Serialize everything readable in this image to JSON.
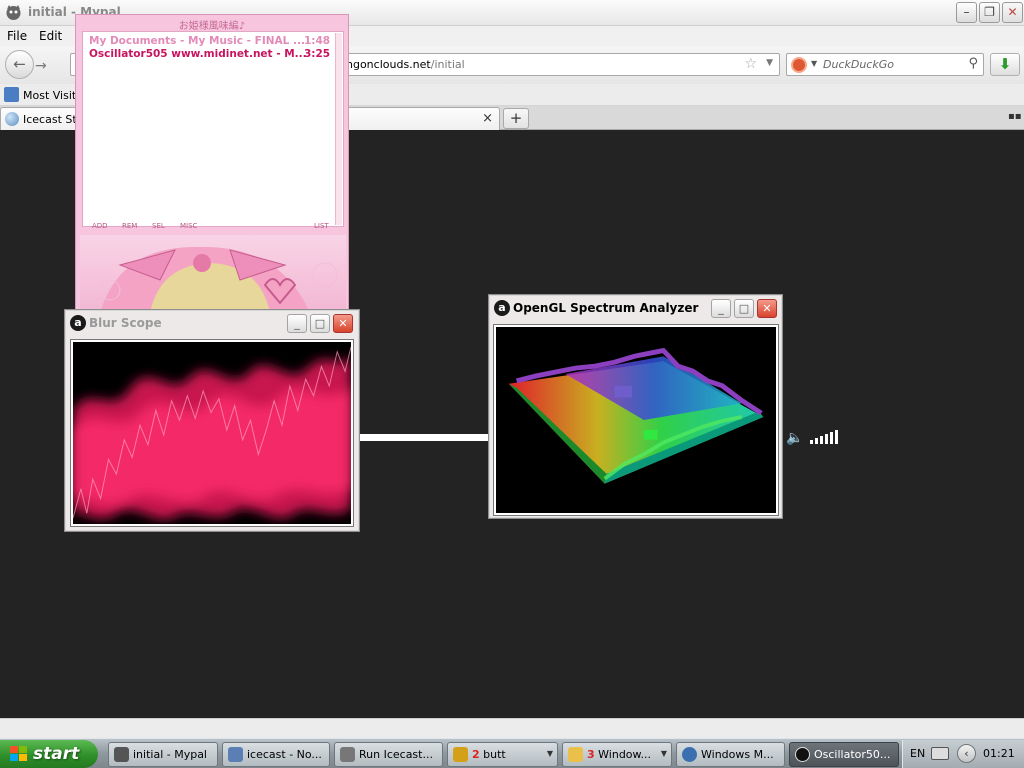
{
  "window": {
    "title": "initial - Mypal",
    "minimize_glyph": "–",
    "maximize_glyph": "❐",
    "close_glyph": "✕"
  },
  "menu": {
    "file": "File",
    "edit": "Edit"
  },
  "nav": {
    "back_glyph": "←",
    "forward_glyph": "→",
    "url_host": "ngonclouds.net",
    "url_path": "/initial",
    "star_glyph": "☆",
    "dropdown_glyph": "▼",
    "search_placeholder": "DuckDuckGo",
    "search_glyph": "⚲",
    "download_glyph": "⬇"
  },
  "bookmarks": {
    "most_visited": "Most Visite"
  },
  "tabs": {
    "active_label": "Icecast Str",
    "close_glyph": "×",
    "new_tab_glyph": "+",
    "all_tabs_glyph": "▪▪"
  },
  "playlist": {
    "title": "お姫様風味編♪",
    "items": [
      {
        "title": "My Documents - My Music - FINAL ...",
        "duration": "1:48",
        "color": "#e38ab8"
      },
      {
        "title": "Oscillator505 www.midinet.net - M...",
        "duration": "3:25",
        "color": "#c8145f"
      }
    ],
    "buttons": [
      "ADD",
      "REM",
      "SEL",
      "MISC",
      "LIST"
    ]
  },
  "blur_scope": {
    "title": "Blur Scope",
    "icon_glyph": "a",
    "min_glyph": "_",
    "max_glyph": "□",
    "close_glyph": "✕"
  },
  "spectrum": {
    "title": "OpenGL Spectrum Analyzer",
    "icon_glyph": "a",
    "min_glyph": "_",
    "max_glyph": "□",
    "close_glyph": "✕"
  },
  "speaker_glyph": "🔈",
  "taskbar": {
    "start": "start",
    "items": [
      {
        "label": "initial - Mypal",
        "icon_color": "#555"
      },
      {
        "label": "icecast - No...",
        "icon_color": "#5b7fb5"
      },
      {
        "label": "Run Icecast...",
        "icon_color": "#777"
      },
      {
        "num": "2",
        "label": "butt",
        "icon_color": "#d4a017",
        "arrow": "▼"
      },
      {
        "num": "3",
        "label": "Window...",
        "icon_color": "#e8c04a",
        "arrow": "▼"
      },
      {
        "label": "Windows M...",
        "icon_color": "#3a6fb0"
      },
      {
        "label": "Oscillator50...",
        "icon_color": "#111"
      }
    ],
    "tray": {
      "lang": "EN",
      "chevron": "‹",
      "clock": "01:21"
    }
  }
}
